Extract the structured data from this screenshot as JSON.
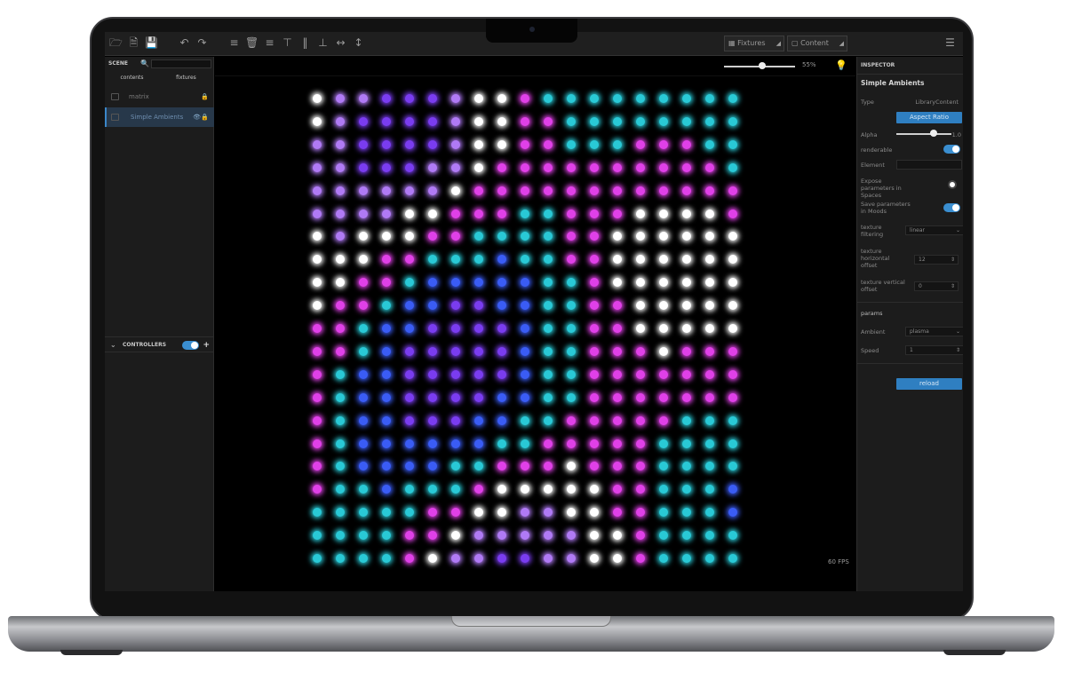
{
  "toolbar": {
    "fixtures_label": "Fixtures",
    "content_label": "Content"
  },
  "scene": {
    "header": "SCENE",
    "tabs": [
      "contents",
      "fixtures"
    ],
    "items": [
      {
        "label": "matrix"
      },
      {
        "label": "Simple Ambients"
      }
    ]
  },
  "controllers": {
    "header": "CONTROLLERS",
    "enabled": true
  },
  "viewport": {
    "zoom_label": "55%",
    "zoom_level": 0.55,
    "fps_label": "60 FPS"
  },
  "inspector": {
    "header": "INSPECTOR",
    "title": "Simple Ambients",
    "type_label": "Type",
    "type_value": "LibraryContent",
    "aspect_button": "Aspect Ratio",
    "alpha_label": "Alpha",
    "alpha_value": "1.0",
    "renderable_label": "renderable",
    "renderable_on": true,
    "element_label": "Element",
    "expose_label": "Expose parameters in Spaces",
    "expose_on": false,
    "save_label": "Save parameters in Moods",
    "save_on": true,
    "texture_filtering_label": "texture filtering",
    "texture_filtering_value": "linear",
    "texture_h_offset_label": "texture horizontal offset",
    "texture_h_offset_value": "12",
    "texture_v_offset_label": "texture vertical offset",
    "texture_v_offset_value": "0",
    "params_header": "params",
    "ambient_label": "Ambient",
    "ambient_value": "plasma",
    "speed_label": "Speed",
    "speed_value": "1",
    "reload_button": "reload"
  },
  "colors": {
    "accent": "#2f7fc1",
    "panel": "#1c1c1c",
    "led_palette": [
      "#7a3cf0",
      "#3a5cf5",
      "#29c9d6",
      "#e040e8",
      "#ffffff",
      "#b07af5"
    ]
  }
}
